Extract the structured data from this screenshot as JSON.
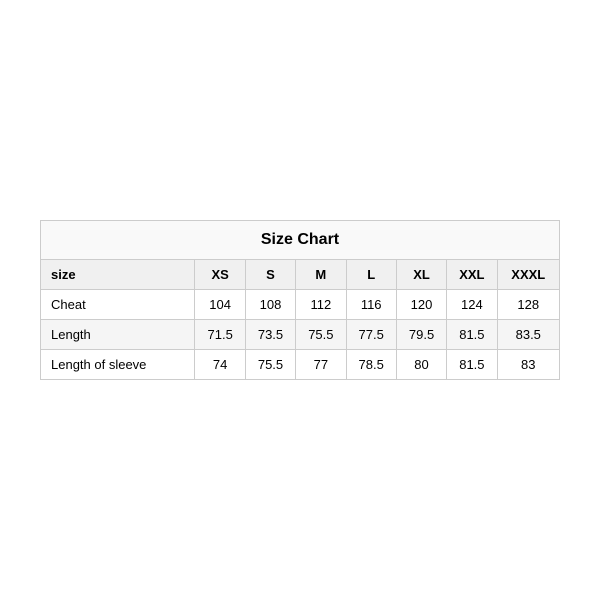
{
  "table": {
    "title": "Size Chart",
    "headers": [
      "size",
      "XS",
      "S",
      "M",
      "L",
      "XL",
      "XXL",
      "XXXL"
    ],
    "rows": [
      {
        "label": "Cheat",
        "values": [
          "104",
          "108",
          "112",
          "116",
          "120",
          "124",
          "128"
        ],
        "alt": false
      },
      {
        "label": "Length",
        "values": [
          "71.5",
          "73.5",
          "75.5",
          "77.5",
          "79.5",
          "81.5",
          "83.5"
        ],
        "alt": true
      },
      {
        "label": "Length of sleeve",
        "values": [
          "74",
          "75.5",
          "77",
          "78.5",
          "80",
          "81.5",
          "83"
        ],
        "alt": false
      }
    ]
  }
}
